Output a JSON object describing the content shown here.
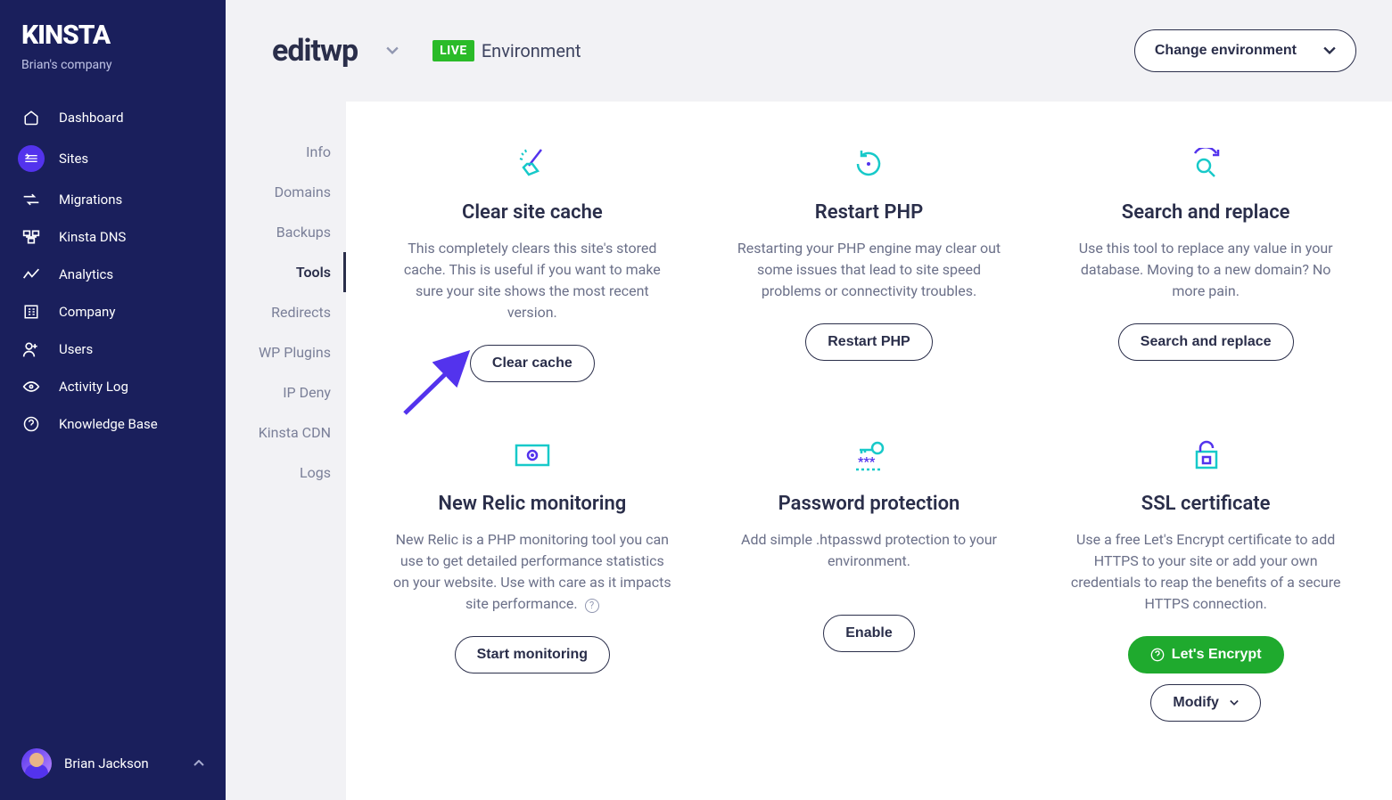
{
  "brand": "KINSTA",
  "company": "Brian's company",
  "nav": {
    "dashboard": "Dashboard",
    "sites": "Sites",
    "migrations": "Migrations",
    "dns": "Kinsta DNS",
    "analytics": "Analytics",
    "company_item": "Company",
    "users": "Users",
    "activity": "Activity Log",
    "kb": "Knowledge Base"
  },
  "user": {
    "name": "Brian Jackson"
  },
  "header": {
    "site_name": "editwp",
    "badge": "LIVE",
    "env_label": "Environment",
    "change_env": "Change environment"
  },
  "subnav": {
    "info": "Info",
    "domains": "Domains",
    "backups": "Backups",
    "tools": "Tools",
    "redirects": "Redirects",
    "wp_plugins": "WP Plugins",
    "ip_deny": "IP Deny",
    "cdn": "Kinsta CDN",
    "logs": "Logs"
  },
  "cards": {
    "clear_cache": {
      "title": "Clear site cache",
      "desc": "This completely clears this site's stored cache. This is useful if you want to make sure your site shows the most recent version.",
      "btn": "Clear cache"
    },
    "restart_php": {
      "title": "Restart PHP",
      "desc": "Restarting your PHP engine may clear out some issues that lead to site speed problems or connectivity troubles.",
      "btn": "Restart PHP"
    },
    "search_replace": {
      "title": "Search and replace",
      "desc": "Use this tool to replace any value in your database. Moving to a new domain? No more pain.",
      "btn": "Search and replace"
    },
    "new_relic": {
      "title": "New Relic monitoring",
      "desc": "New Relic is a PHP monitoring tool you can use to get detailed performance statistics on your website. Use with care as it impacts site performance.",
      "btn": "Start monitoring"
    },
    "password": {
      "title": "Password protection",
      "desc": "Add simple .htpasswd protection to your environment.",
      "btn": "Enable"
    },
    "ssl": {
      "title": "SSL certificate",
      "desc": "Use a free Let's Encrypt certificate to add HTTPS to your site or add your own credentials to reap the benefits of a secure HTTPS connection.",
      "btn_primary": "Let's Encrypt",
      "btn_secondary": "Modify"
    }
  }
}
